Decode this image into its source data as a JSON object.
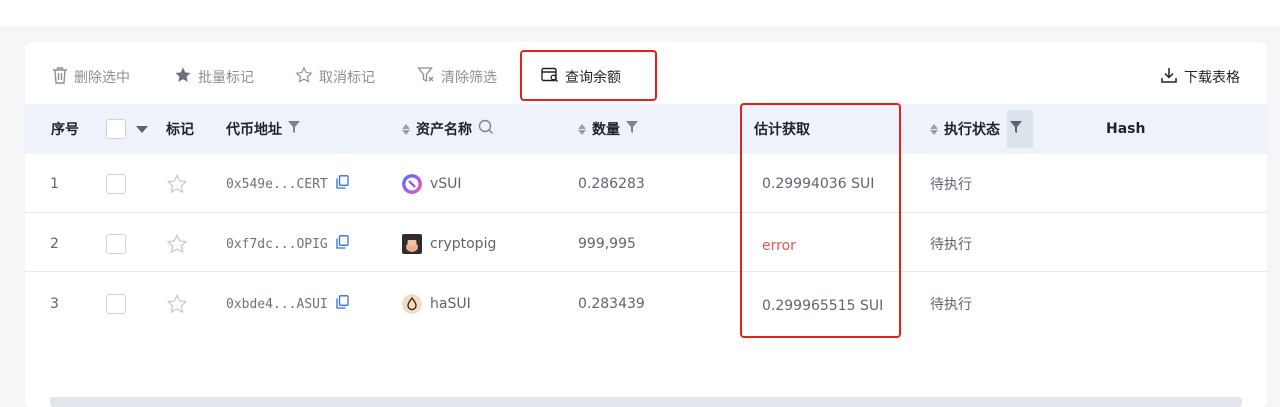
{
  "toolbar": {
    "delete_selected": "删除选中",
    "batch_mark": "批量标记",
    "unmark": "取消标记",
    "clear_filter": "清除筛选",
    "query_balance": "查询余额",
    "download_table": "下载表格"
  },
  "columns": {
    "index": "序号",
    "mark": "标记",
    "token_address": "代币地址",
    "asset_name": "资产名称",
    "quantity": "数量",
    "estimated": "估计获取",
    "exec_status": "执行状态",
    "hash": "Hash"
  },
  "rows": [
    {
      "index": "1",
      "address": "0x549e...CERT",
      "name": "vSUI",
      "quantity": "0.286283",
      "estimated": "0.29994036 SUI",
      "status": "待执行",
      "icon": "vsui-token-icon"
    },
    {
      "index": "2",
      "address": "0xf7dc...OPIG",
      "name": "cryptopig",
      "quantity": "999,995",
      "estimated": "error",
      "status": "待执行",
      "icon": "cryptopig-token-icon"
    },
    {
      "index": "3",
      "address": "0xbde4...ASUI",
      "name": "haSUI",
      "quantity": "0.283439",
      "estimated": "0.299965515 SUI",
      "status": "待执行",
      "icon": "hasui-token-icon"
    }
  ],
  "colors": {
    "highlight_box": "#e2231a",
    "error_text": "#e05a52",
    "header_bg": "#eef3fb",
    "copy_icon": "#2f6fe4"
  }
}
